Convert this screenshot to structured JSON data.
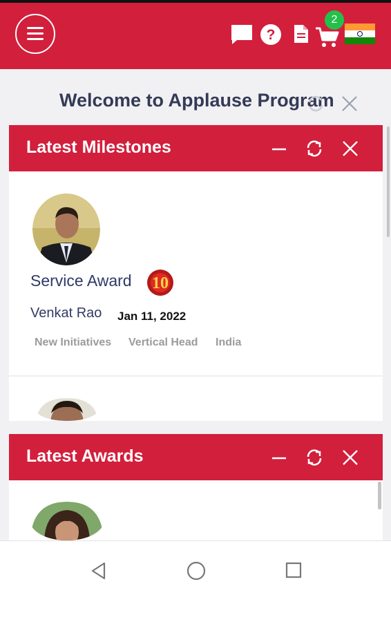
{
  "header": {
    "cart_count": "2",
    "icons": [
      "menu-icon",
      "chat-icon",
      "help-icon",
      "document-icon",
      "cart-icon",
      "india-flag-icon"
    ]
  },
  "welcome": {
    "text": "Welcome to Applause Program"
  },
  "milestones": {
    "title": "Latest Milestones",
    "items": [
      {
        "award": "Service Award",
        "years_badge": "10",
        "name": "Venkat Rao",
        "date": "Jan 11, 2022",
        "tags": [
          "New Initiatives",
          "Vertical Head",
          "India"
        ]
      }
    ]
  },
  "awards": {
    "title": "Latest Awards"
  },
  "colors": {
    "brand_red": "#d21f3c",
    "text_navy": "#2f3a66",
    "badge_green": "#23c14b",
    "tag_gray": "#9b9b9b"
  }
}
